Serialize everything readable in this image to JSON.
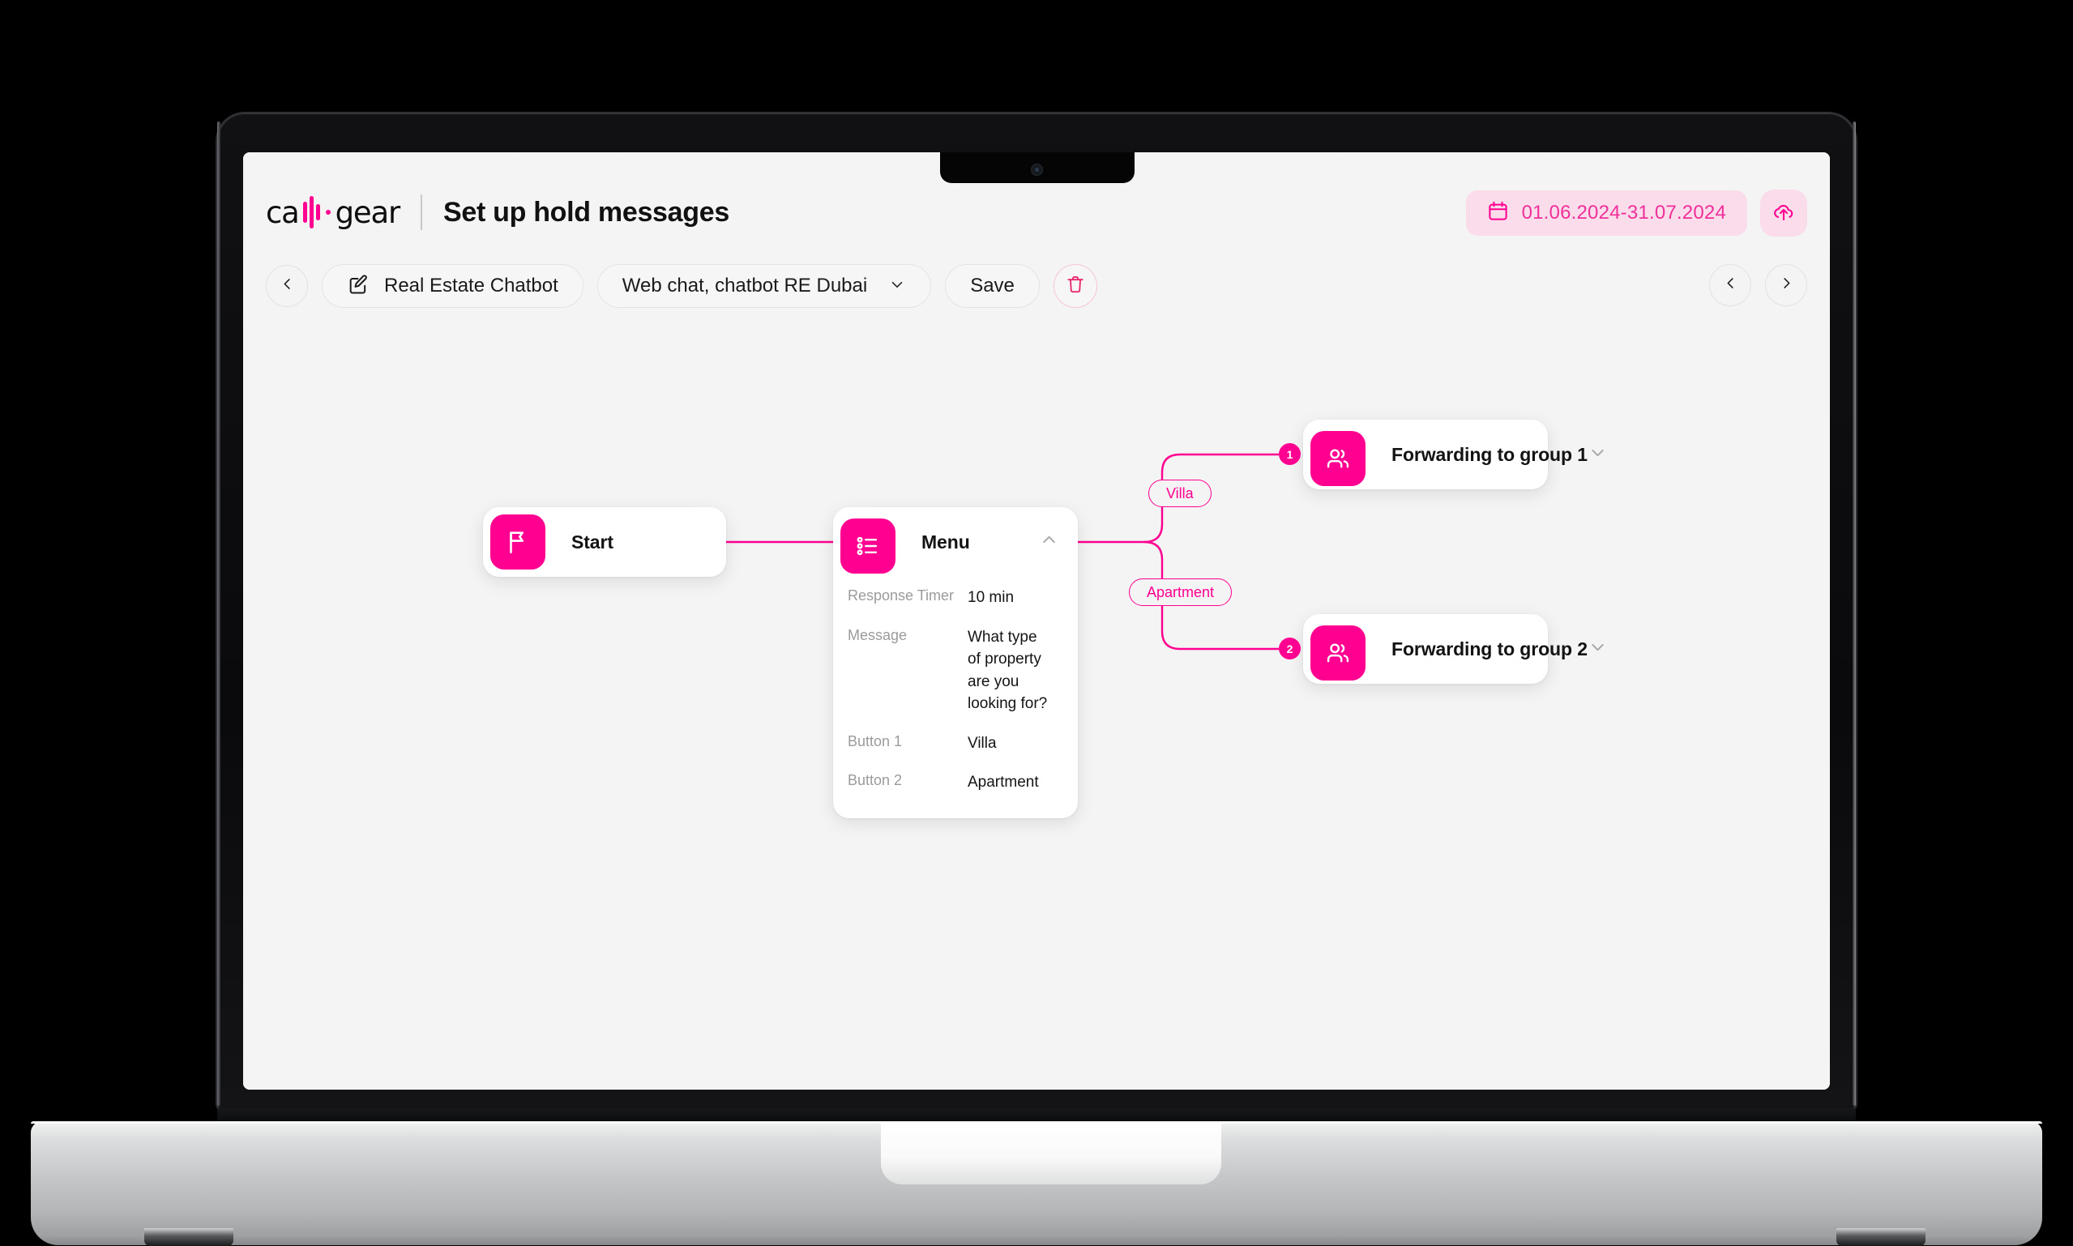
{
  "header": {
    "brand_name": "callgear",
    "brand_prefix": "ca",
    "brand_suffix": "gear",
    "page_title": "Set up hold messages",
    "date_range": "01.06.2024-31.07.2024",
    "calendar_icon": "calendar-icon",
    "upload_icon": "cloud-upload-icon",
    "accent_pink": "#ff0090",
    "chip_bg": "#fbdceb"
  },
  "toolbar": {
    "back_label": "back",
    "back_icon": "chevron-left-icon",
    "chatbot_name": "Real Estate Chatbot",
    "edit_icon": "edit-pencil-icon",
    "channel_select": "Web chat, chatbot RE Dubai",
    "channel_caret": "chevron-down-icon",
    "save_label": "Save",
    "delete_icon": "trash-icon",
    "prev_icon": "chevron-left-icon",
    "next_icon": "chevron-right-icon"
  },
  "flow": {
    "nodes": [
      {
        "id": "start",
        "title": "Start",
        "icon": "flag-icon"
      },
      {
        "id": "menu",
        "title": "Menu",
        "icon": "list-icon",
        "collapse_icon": "chevron-up-icon",
        "fields": [
          {
            "label": "Response Timer",
            "value": "10 min"
          },
          {
            "label": "Message",
            "value": "What type\nof property are you\nlooking for?"
          },
          {
            "label": "Button 1",
            "value": "Villa"
          },
          {
            "label": "Button 2",
            "value": "Apartment"
          }
        ]
      },
      {
        "id": "forward-1",
        "title": "Forwarding to group 1",
        "icon": "users-group-icon",
        "caret_icon": "chevron-down-icon",
        "port": "1"
      },
      {
        "id": "forward-2",
        "title": "Forwarding to group 2",
        "icon": "users-group-icon",
        "caret_icon": "chevron-down-icon",
        "port": "2"
      }
    ],
    "edge_labels": [
      {
        "id": "villa",
        "text": "Villa"
      },
      {
        "id": "apartment",
        "text": "Apartment"
      }
    ]
  }
}
